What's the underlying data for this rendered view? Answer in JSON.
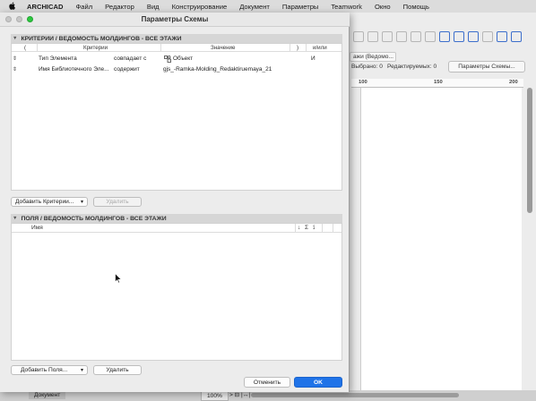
{
  "menubar": {
    "apple": "",
    "app_name": "ARCHICAD",
    "items": [
      "Файл",
      "Редактор",
      "Вид",
      "Конструирование",
      "Документ",
      "Параметры",
      "Teamwork",
      "Окно",
      "Помощь"
    ]
  },
  "dialog": {
    "title": "Параметры Схемы",
    "criteria": {
      "header": "КРИТЕРИИ / ВЕДОМОСТЬ МОЛДИНГОВ - ВСЕ ЭТАЖИ",
      "columns": {
        "open_paren": "(",
        "criteria": "Критерии",
        "value": "Значение",
        "close_paren": ")",
        "and_or": "и/или"
      },
      "rows": [
        {
          "grip": "⇕",
          "name": "Тип Элемента",
          "op": "совпадает с",
          "icon": "object-icon",
          "value": "Объект",
          "and_or": "И"
        },
        {
          "grip": "⇕",
          "name": "Имя Библиотечного Эле...",
          "op": "содержит",
          "icon": "",
          "value": "gjs_-Ramka-Molding_Redaktiruemaya_21",
          "and_or": ""
        }
      ],
      "add_button": "Добавить Критерии...",
      "delete_button": "Удалить"
    },
    "fields": {
      "header": "ПОЛЯ / ВЕДОМОСТЬ МОЛДИНГОВ - ВСЕ ЭТАЖИ",
      "columns": {
        "name": "Имя",
        "sort": "↓",
        "sum": "Σ",
        "pin": "⟟"
      },
      "add_button": "Добавить Поля...",
      "delete_button": "Удалить"
    },
    "cancel_button": "Отменить",
    "ok_button": "OK"
  },
  "background_app": {
    "tab_label": "ажи (Ведомо...",
    "selected_label": "Выбрано: 0",
    "editable_label": "Редактируемых: 0",
    "scheme_params_button": "Параметры Схемы...",
    "ruler_marks": [
      "100",
      "150",
      "200"
    ],
    "document_label": "Документ",
    "zoom": "100%",
    "nav_arrows": "> ⊟ |↔|"
  },
  "colors": {
    "accent": "#1f73e8",
    "zoom_button": "#2dc840"
  }
}
